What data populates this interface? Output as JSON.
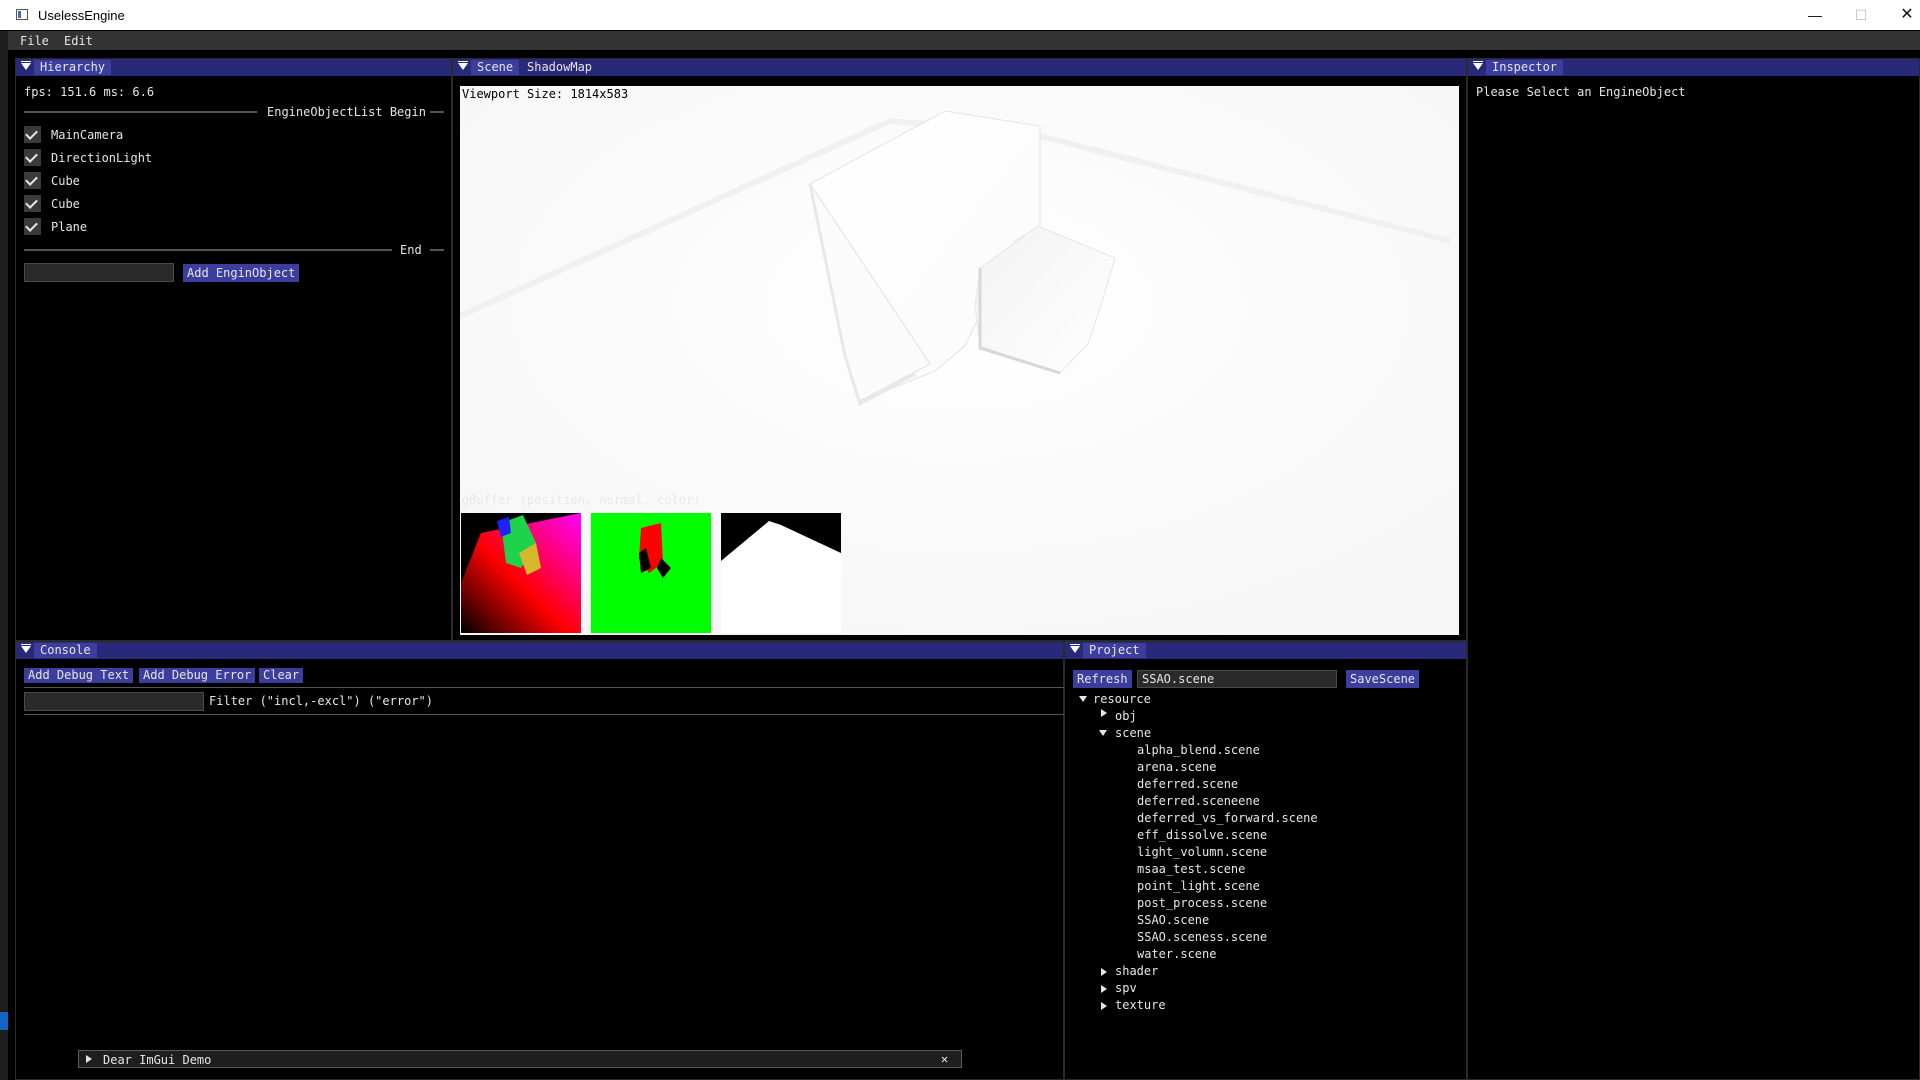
{
  "window": {
    "title": "UselessEngine",
    "minimize_glyph": "—",
    "maximize_glyph": "☐",
    "close_glyph": "✕"
  },
  "menu": [
    "File",
    "Edit"
  ],
  "hierarchy": {
    "tab": "Hierarchy",
    "fps_line": "fps: 151.6 ms: 6.6",
    "list_begin": "EngineObjectList Begin",
    "list_end": "End",
    "objects": [
      "MainCamera",
      "DirectionLight",
      "Cube",
      "Cube",
      "Plane"
    ],
    "new_object_input": "",
    "add_button": "Add EnginObject"
  },
  "scene": {
    "tabs": [
      "Scene",
      "ShadowMap"
    ],
    "active_tab": "Scene",
    "viewport_size_text": "Viewport Size: 1814x583",
    "gbuffer_label": "gBuffer (position, normal, color)"
  },
  "inspector": {
    "tab": "Inspector",
    "message": "Please Select an EngineObject"
  },
  "console": {
    "tab": "Console",
    "buttons": [
      "Add Debug Text",
      "Add Debug Error",
      "Clear"
    ],
    "filter_input": "",
    "filter_hint": "Filter (\"incl,-excl\") (\"error\")"
  },
  "project": {
    "tab": "Project",
    "refresh": "Refresh",
    "scene_name": "SSAO.scene",
    "save": "SaveScene",
    "root": "resource",
    "folders": [
      "obj",
      "scene",
      "shader",
      "spv",
      "texture"
    ],
    "scene_files": [
      "alpha_blend.scene",
      "arena.scene",
      "deferred.scene",
      "deferred.sceneene",
      "deferred_vs_forward.scene",
      "eff_dissolve.scene",
      "light_volumn.scene",
      "msaa_test.scene",
      "point_light.scene",
      "post_process.scene",
      "SSAO.scene",
      "SSAO.sceness.scene",
      "water.scene"
    ]
  },
  "demo_window": {
    "title": "Dear ImGui Demo",
    "close_glyph": "✕"
  },
  "colors": {
    "tab_active": "#3d3d9e",
    "header_bg": "#29297a",
    "button": "#3d3d9e",
    "accent_blue": "#1565c0"
  }
}
